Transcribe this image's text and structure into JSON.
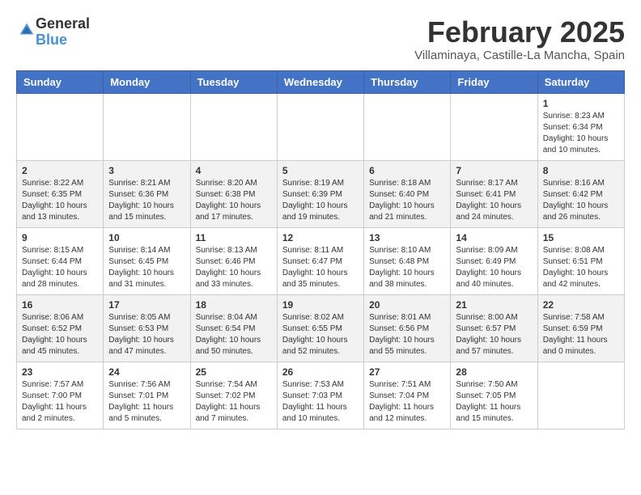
{
  "header": {
    "logo": {
      "general": "General",
      "blue": "Blue"
    },
    "title": "February 2025",
    "location": "Villaminaya, Castille-La Mancha, Spain"
  },
  "calendar": {
    "headers": [
      "Sunday",
      "Monday",
      "Tuesday",
      "Wednesday",
      "Thursday",
      "Friday",
      "Saturday"
    ],
    "weeks": [
      [
        {
          "day": "",
          "info": ""
        },
        {
          "day": "",
          "info": ""
        },
        {
          "day": "",
          "info": ""
        },
        {
          "day": "",
          "info": ""
        },
        {
          "day": "",
          "info": ""
        },
        {
          "day": "",
          "info": ""
        },
        {
          "day": "1",
          "info": "Sunrise: 8:23 AM\nSunset: 6:34 PM\nDaylight: 10 hours and 10 minutes."
        }
      ],
      [
        {
          "day": "2",
          "info": "Sunrise: 8:22 AM\nSunset: 6:35 PM\nDaylight: 10 hours and 13 minutes."
        },
        {
          "day": "3",
          "info": "Sunrise: 8:21 AM\nSunset: 6:36 PM\nDaylight: 10 hours and 15 minutes."
        },
        {
          "day": "4",
          "info": "Sunrise: 8:20 AM\nSunset: 6:38 PM\nDaylight: 10 hours and 17 minutes."
        },
        {
          "day": "5",
          "info": "Sunrise: 8:19 AM\nSunset: 6:39 PM\nDaylight: 10 hours and 19 minutes."
        },
        {
          "day": "6",
          "info": "Sunrise: 8:18 AM\nSunset: 6:40 PM\nDaylight: 10 hours and 21 minutes."
        },
        {
          "day": "7",
          "info": "Sunrise: 8:17 AM\nSunset: 6:41 PM\nDaylight: 10 hours and 24 minutes."
        },
        {
          "day": "8",
          "info": "Sunrise: 8:16 AM\nSunset: 6:42 PM\nDaylight: 10 hours and 26 minutes."
        }
      ],
      [
        {
          "day": "9",
          "info": "Sunrise: 8:15 AM\nSunset: 6:44 PM\nDaylight: 10 hours and 28 minutes."
        },
        {
          "day": "10",
          "info": "Sunrise: 8:14 AM\nSunset: 6:45 PM\nDaylight: 10 hours and 31 minutes."
        },
        {
          "day": "11",
          "info": "Sunrise: 8:13 AM\nSunset: 6:46 PM\nDaylight: 10 hours and 33 minutes."
        },
        {
          "day": "12",
          "info": "Sunrise: 8:11 AM\nSunset: 6:47 PM\nDaylight: 10 hours and 35 minutes."
        },
        {
          "day": "13",
          "info": "Sunrise: 8:10 AM\nSunset: 6:48 PM\nDaylight: 10 hours and 38 minutes."
        },
        {
          "day": "14",
          "info": "Sunrise: 8:09 AM\nSunset: 6:49 PM\nDaylight: 10 hours and 40 minutes."
        },
        {
          "day": "15",
          "info": "Sunrise: 8:08 AM\nSunset: 6:51 PM\nDaylight: 10 hours and 42 minutes."
        }
      ],
      [
        {
          "day": "16",
          "info": "Sunrise: 8:06 AM\nSunset: 6:52 PM\nDaylight: 10 hours and 45 minutes."
        },
        {
          "day": "17",
          "info": "Sunrise: 8:05 AM\nSunset: 6:53 PM\nDaylight: 10 hours and 47 minutes."
        },
        {
          "day": "18",
          "info": "Sunrise: 8:04 AM\nSunset: 6:54 PM\nDaylight: 10 hours and 50 minutes."
        },
        {
          "day": "19",
          "info": "Sunrise: 8:02 AM\nSunset: 6:55 PM\nDaylight: 10 hours and 52 minutes."
        },
        {
          "day": "20",
          "info": "Sunrise: 8:01 AM\nSunset: 6:56 PM\nDaylight: 10 hours and 55 minutes."
        },
        {
          "day": "21",
          "info": "Sunrise: 8:00 AM\nSunset: 6:57 PM\nDaylight: 10 hours and 57 minutes."
        },
        {
          "day": "22",
          "info": "Sunrise: 7:58 AM\nSunset: 6:59 PM\nDaylight: 11 hours and 0 minutes."
        }
      ],
      [
        {
          "day": "23",
          "info": "Sunrise: 7:57 AM\nSunset: 7:00 PM\nDaylight: 11 hours and 2 minutes."
        },
        {
          "day": "24",
          "info": "Sunrise: 7:56 AM\nSunset: 7:01 PM\nDaylight: 11 hours and 5 minutes."
        },
        {
          "day": "25",
          "info": "Sunrise: 7:54 AM\nSunset: 7:02 PM\nDaylight: 11 hours and 7 minutes."
        },
        {
          "day": "26",
          "info": "Sunrise: 7:53 AM\nSunset: 7:03 PM\nDaylight: 11 hours and 10 minutes."
        },
        {
          "day": "27",
          "info": "Sunrise: 7:51 AM\nSunset: 7:04 PM\nDaylight: 11 hours and 12 minutes."
        },
        {
          "day": "28",
          "info": "Sunrise: 7:50 AM\nSunset: 7:05 PM\nDaylight: 11 hours and 15 minutes."
        },
        {
          "day": "",
          "info": ""
        }
      ]
    ]
  }
}
